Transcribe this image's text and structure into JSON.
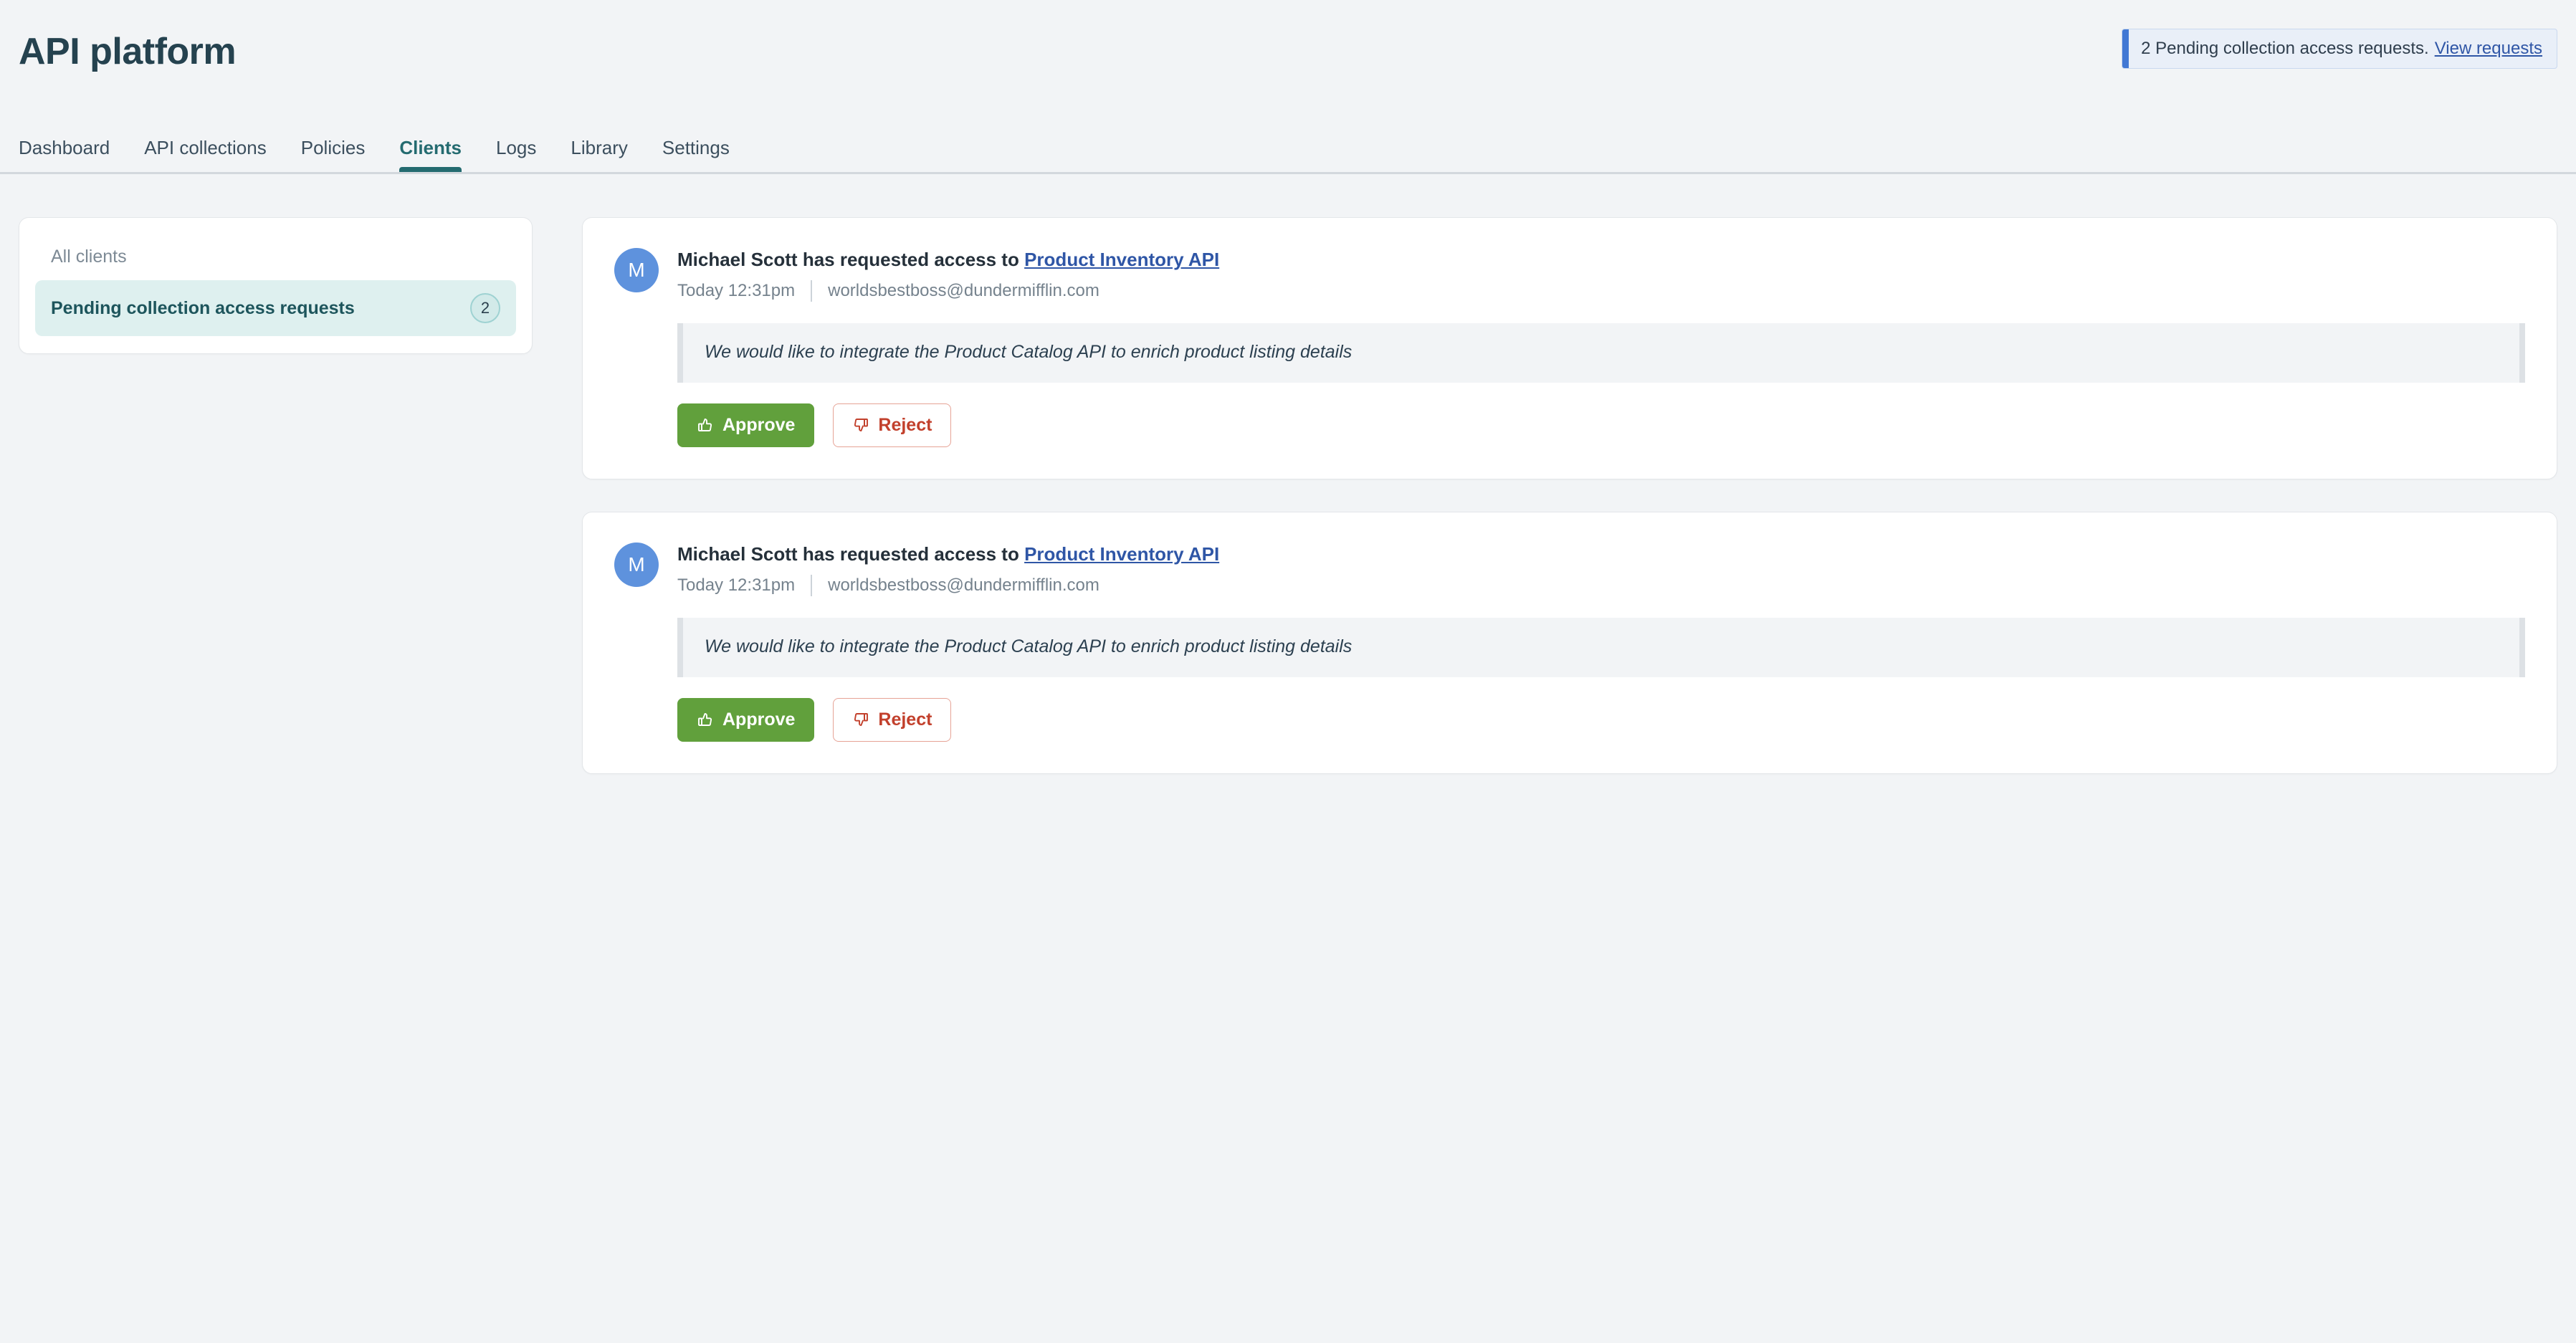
{
  "header": {
    "title": "API platform",
    "notice": {
      "text": "2 Pending collection access requests.",
      "link_label": "View requests",
      "accent_color": "#4178d4",
      "background_color": "#e9eff8"
    }
  },
  "tabs": [
    {
      "label": "Dashboard",
      "active": false
    },
    {
      "label": "API collections",
      "active": false
    },
    {
      "label": "Policies",
      "active": false
    },
    {
      "label": "Clients",
      "active": true
    },
    {
      "label": "Logs",
      "active": false
    },
    {
      "label": "Library",
      "active": false
    },
    {
      "label": "Settings",
      "active": false
    }
  ],
  "sidebar": {
    "items": [
      {
        "label": "All clients",
        "badge": "",
        "active": false
      },
      {
        "label": "Pending collection access requests",
        "badge": "2",
        "active": true
      }
    ],
    "active_color": "#def0ef"
  },
  "requests": [
    {
      "avatar_initial": "M",
      "avatar_color": "#5e92dd",
      "title_prefix": "Michael Scott has requested access to",
      "collection_link": "Product Inventory API",
      "timestamp": "Today 12:31pm",
      "email": "worldsbestboss@dundermifflin.com",
      "message": "We would like to integrate the Product Catalog API to enrich product listing details",
      "approve_label": "Approve",
      "reject_label": "Reject"
    },
    {
      "avatar_initial": "M",
      "avatar_color": "#5e92dd",
      "title_prefix": "Michael Scott has requested access to",
      "collection_link": "Product Inventory API",
      "timestamp": "Today 12:31pm",
      "email": "worldsbestboss@dundermifflin.com",
      "message": "We would like to integrate the Product Catalog API to enrich product listing details",
      "approve_label": "Approve",
      "reject_label": "Reject"
    }
  ],
  "colors": {
    "page_background": "#f2f4f6",
    "card_background": "#ffffff",
    "accent_teal": "#246b70",
    "approve_green": "#61a03c",
    "reject_red": "#c2402c",
    "link_blue": "#2f56a6"
  }
}
